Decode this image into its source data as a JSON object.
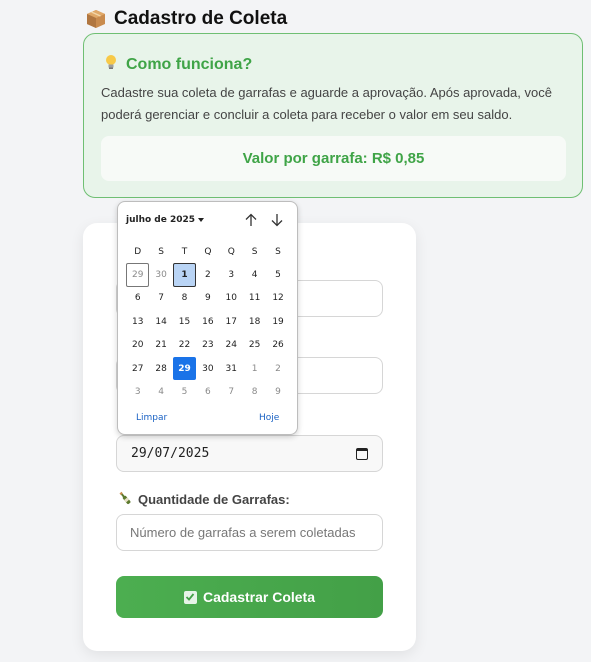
{
  "page": {
    "title": "Cadastro de Coleta"
  },
  "info": {
    "heading": "Como funciona?",
    "text": "Cadastre sua coleta de garrafas e aguarde a aprovação. Após aprovada, você poderá gerenciar e concluir a coleta para receber o valor em seu saldo.",
    "price_label": "Valor por garrafa: R$ 0,85"
  },
  "form": {
    "date_value": "29/07/2025",
    "qty_label": "Quantidade de Garrafas:",
    "qty_placeholder": "Número de garrafas a serem coletadas",
    "submit_label": "Cadastrar Coleta"
  },
  "calendar": {
    "month_label": "julho de 2025",
    "weekdays": [
      "D",
      "S",
      "T",
      "Q",
      "Q",
      "S",
      "S"
    ],
    "weeks": [
      [
        "29",
        "30",
        "1",
        "2",
        "3",
        "4",
        "5"
      ],
      [
        "6",
        "7",
        "8",
        "9",
        "10",
        "11",
        "12"
      ],
      [
        "13",
        "14",
        "15",
        "16",
        "17",
        "18",
        "19"
      ],
      [
        "20",
        "21",
        "22",
        "23",
        "24",
        "25",
        "26"
      ],
      [
        "27",
        "28",
        "29",
        "30",
        "31",
        "1",
        "2"
      ],
      [
        "3",
        "4",
        "5",
        "6",
        "7",
        "8",
        "9"
      ]
    ],
    "clear_label": "Limpar",
    "today_label": "Hoje"
  },
  "colors": {
    "accent_green": "#3fa447",
    "info_bg": "#e8f4ea",
    "selected_blue": "#1a73e8"
  }
}
